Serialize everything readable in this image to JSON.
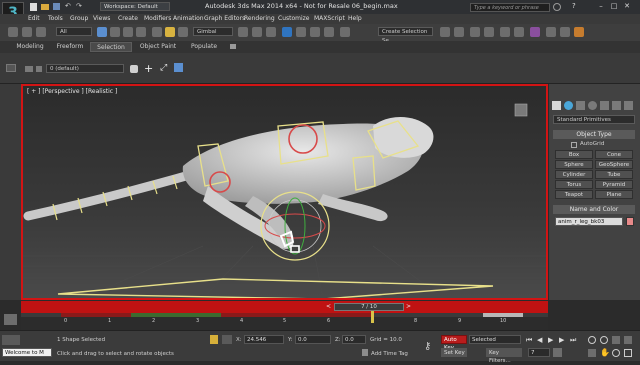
{
  "window": {
    "title": "Autodesk 3ds Max  2014 x64  - Not for Resale   06_begin.max",
    "workspace": "Workspace: Default",
    "search_placeholder": "Type a keyword or phrase"
  },
  "menu": [
    "Edit",
    "Tools",
    "Group",
    "Views",
    "Create",
    "Modifiers",
    "Animation",
    "Graph Editors",
    "Rendering",
    "Customize",
    "MAXScript",
    "Help"
  ],
  "toolbar": {
    "filter_value": "All",
    "coord_value": "Gimbal",
    "selection_set_placeholder": "Create Selection Se"
  },
  "ribbon": {
    "tabs": [
      "Modeling",
      "Freeform",
      "Selection",
      "Object Paint",
      "Populate"
    ],
    "active_tab": "Selection",
    "layer_value": "0 (default)"
  },
  "viewport": {
    "label": "[ + ] [Perspective ] [Realistic ]",
    "accent_color": "#d21414"
  },
  "command_panel": {
    "dropdown_value": "Standard Primitives",
    "object_type_header": "Object Type",
    "autogrid_label": "AutoGrid",
    "buttons": [
      "Box",
      "Cone",
      "Sphere",
      "GeoSphere",
      "Cylinder",
      "Tube",
      "Torus",
      "Pyramid",
      "Teapot",
      "Plane"
    ],
    "name_color_header": "Name and Color",
    "object_name": "anim_r_leg_bk03"
  },
  "timeline": {
    "frame_display": "7 / 10",
    "ticks": [
      "0",
      "1",
      "2",
      "3",
      "4",
      "5",
      "6",
      "7",
      "8",
      "9",
      "10"
    ],
    "marker_color": "#c01212"
  },
  "status": {
    "listener_text": "Welcome to M",
    "selection_info": "1 Shape Selected",
    "prompt": "Click and drag to select and rotate objects",
    "x_label": "X:",
    "x_value": "24.546",
    "y_label": "Y:",
    "y_value": "0.0",
    "z_label": "Z:",
    "z_value": "0.0",
    "grid_text": "Grid = 10.0",
    "add_time_tag": "Add Time Tag",
    "auto_key": "Auto Key",
    "auto_key_mode": "Selected",
    "set_key": "Set Key",
    "key_filters": "Key Filters...",
    "current_frame": "7"
  }
}
